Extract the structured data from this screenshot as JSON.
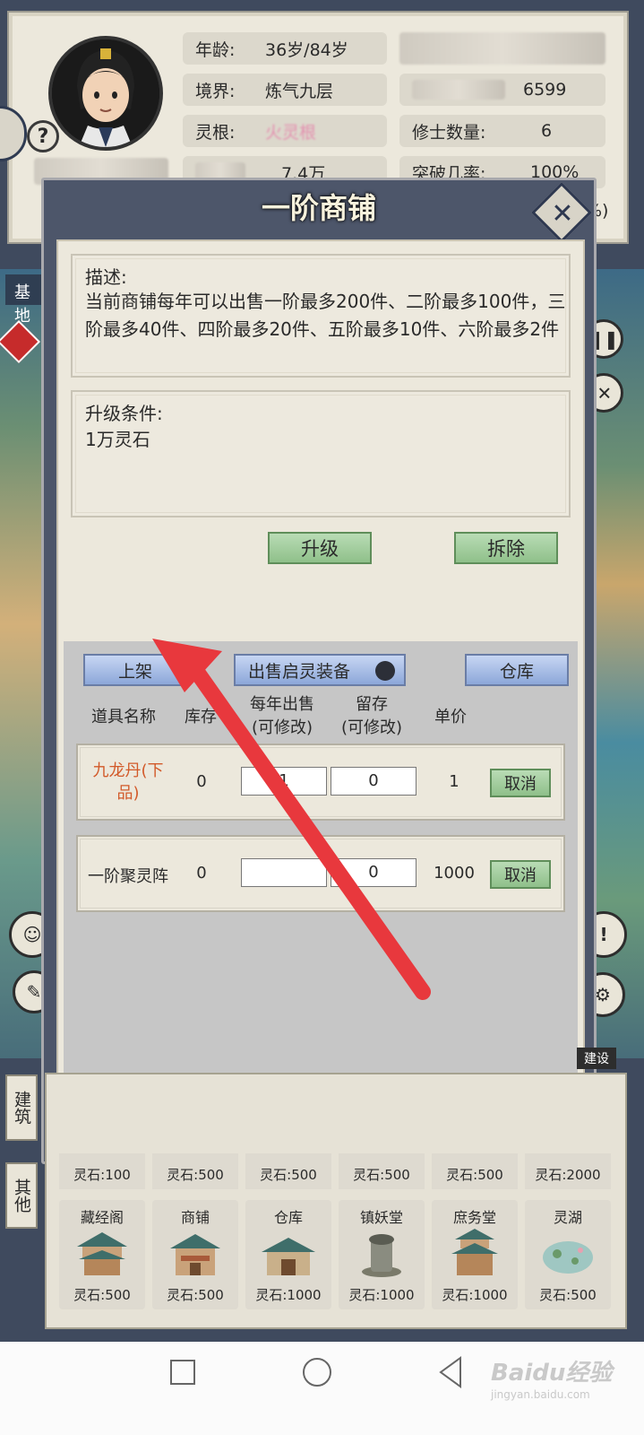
{
  "character": {
    "age_label": "年龄:",
    "age_value": "36岁/84岁",
    "realm_label": "境界:",
    "realm_value": "炼气九层",
    "root_label": "灵根:",
    "root_value": "火灵根",
    "stone_value": "7.4万",
    "sect_value": "6599",
    "cultivator_label": "修士数量:",
    "cultivator_value": "6",
    "breakthrough_label": "突破几率:",
    "breakthrough_value": "100%",
    "partial_value": "%)"
  },
  "base_label": "基地",
  "modal": {
    "title": "一阶商铺",
    "desc_title": "描述:",
    "desc_body": "当前商铺每年可以出售一阶最多200件、二阶最多100件，三阶最多40件、四阶最多20件、五阶最多10件、六阶最多2件",
    "upgrade_title": "升级条件:",
    "upgrade_body": "1万灵石",
    "upgrade_button": "升级",
    "demolish_button": "拆除"
  },
  "shop": {
    "list_button": "上架",
    "sell_toggle_label": "出售启灵装备",
    "storage_button": "仓库",
    "headers": {
      "name": "道具名称",
      "stock": "库存",
      "yearly_sell": "每年出售",
      "yearly_sell_sub": "(可修改)",
      "keep": "留存",
      "keep_sub": "(可修改)",
      "price": "单价"
    },
    "rows": [
      {
        "name": "九龙丹(下品)",
        "stock": "0",
        "sell": "1",
        "keep": "0",
        "price": "1",
        "action": "取消"
      },
      {
        "name": "一阶聚灵阵",
        "stock": "0",
        "sell": "",
        "keep": "0",
        "price": "1000",
        "action": "取消"
      }
    ]
  },
  "build": {
    "tab_build": "建筑",
    "tab_other": "其他",
    "top_tab": "建设",
    "top_prices": [
      "灵石:100",
      "灵石:500",
      "灵石:500",
      "灵石:500",
      "灵石:500",
      "灵石:2000"
    ],
    "cards": [
      {
        "name": "藏经阁",
        "price": "灵石:500"
      },
      {
        "name": "商铺",
        "price": "灵石:500"
      },
      {
        "name": "仓库",
        "price": "灵石:1000"
      },
      {
        "name": "镇妖堂",
        "price": "灵石:1000"
      },
      {
        "name": "庶务堂",
        "price": "灵石:1000"
      },
      {
        "name": "灵湖",
        "price": "灵石:500"
      }
    ]
  },
  "watermark": "Baidu经验",
  "watermark_sub": "jingyan.baidu.com",
  "colors": {
    "item_name_highlight": "#d25a2a",
    "root_value": "#e86aa0",
    "arrow": "#e8383d"
  }
}
